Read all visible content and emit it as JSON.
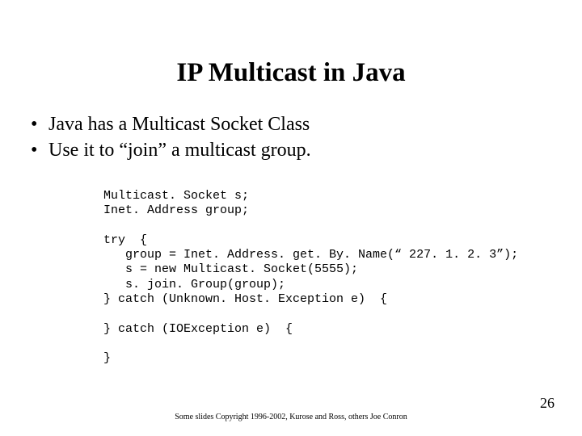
{
  "title": "IP Multicast in Java",
  "bullets": [
    "Java has a Multicast Socket Class",
    "Use it to “join” a multicast group."
  ],
  "code": "Multicast. Socket s;\nInet. Address group;\n\ntry  {\n   group = Inet. Address. get. By. Name(“ 227. 1. 2. 3”);\n   s = new Multicast. Socket(5555);\n   s. join. Group(group);\n} catch (Unknown. Host. Exception e)  {\n\n} catch (IOException e)  {\n\n}",
  "footer": "Some slides Copyright 1996-2002, Kurose and Ross, others Joe Conron",
  "page_number": "26"
}
